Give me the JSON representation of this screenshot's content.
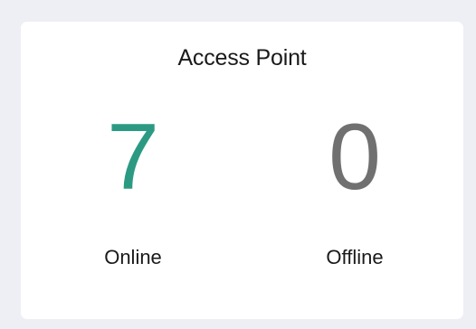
{
  "widget": {
    "title": "Access Point",
    "stats": {
      "online": {
        "value": "7",
        "label": "Online",
        "color": "#2c9a82"
      },
      "offline": {
        "value": "0",
        "label": "Offline",
        "color": "#707070"
      }
    }
  }
}
